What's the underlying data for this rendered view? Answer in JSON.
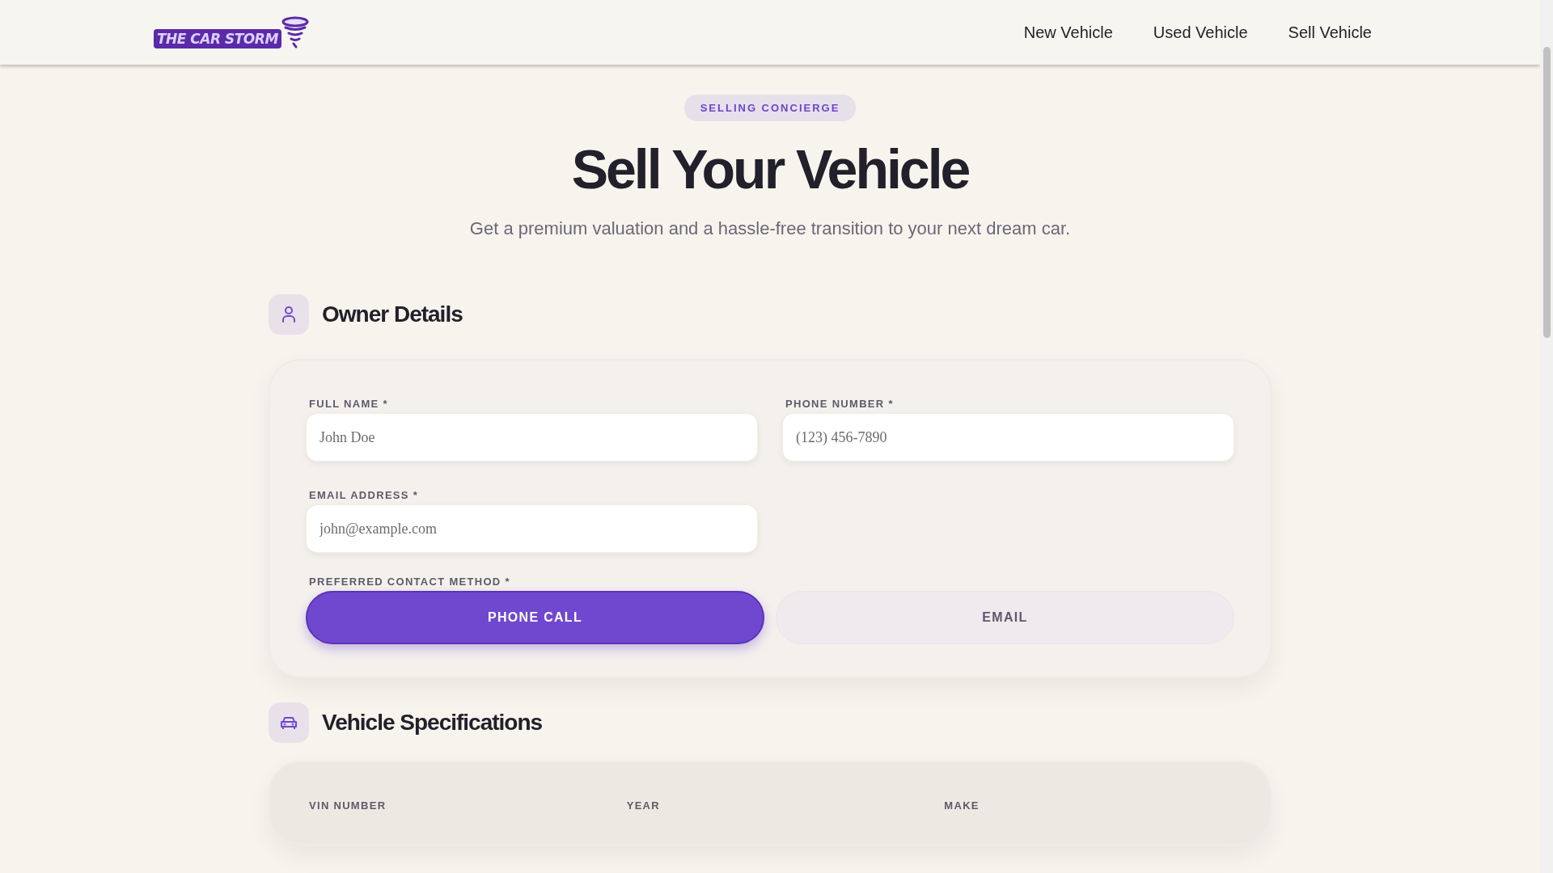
{
  "header": {
    "logo": "THE CAR STORM",
    "nav": [
      {
        "label": "New Vehicle"
      },
      {
        "label": "Used Vehicle"
      },
      {
        "label": "Sell Vehicle"
      }
    ]
  },
  "hero": {
    "badge": "SELLING CONCIERGE",
    "title": "Sell Your Vehicle",
    "subtitle": "Get a premium valuation and a hassle-free transition to your next dream car."
  },
  "owner_details": {
    "heading": "Owner Details",
    "fields": [
      {
        "label": "FULL NAME *",
        "placeholder": "John Doe"
      },
      {
        "label": "PHONE NUMBER *",
        "placeholder": "(123) 456-7890"
      },
      {
        "label": "EMAIL ADDRESS *",
        "placeholder": "john@example.com"
      }
    ],
    "contact_method": {
      "label": "PREFERRED CONTACT METHOD *",
      "options": [
        {
          "label": "PHONE CALL",
          "selected": true
        },
        {
          "label": "EMAIL",
          "selected": false
        }
      ]
    }
  },
  "vehicle_specifications": {
    "heading": "Vehicle Specifications",
    "fields": [
      {
        "label": "VIN NUMBER"
      },
      {
        "label": "YEAR"
      },
      {
        "label": "MAKE"
      }
    ]
  }
}
